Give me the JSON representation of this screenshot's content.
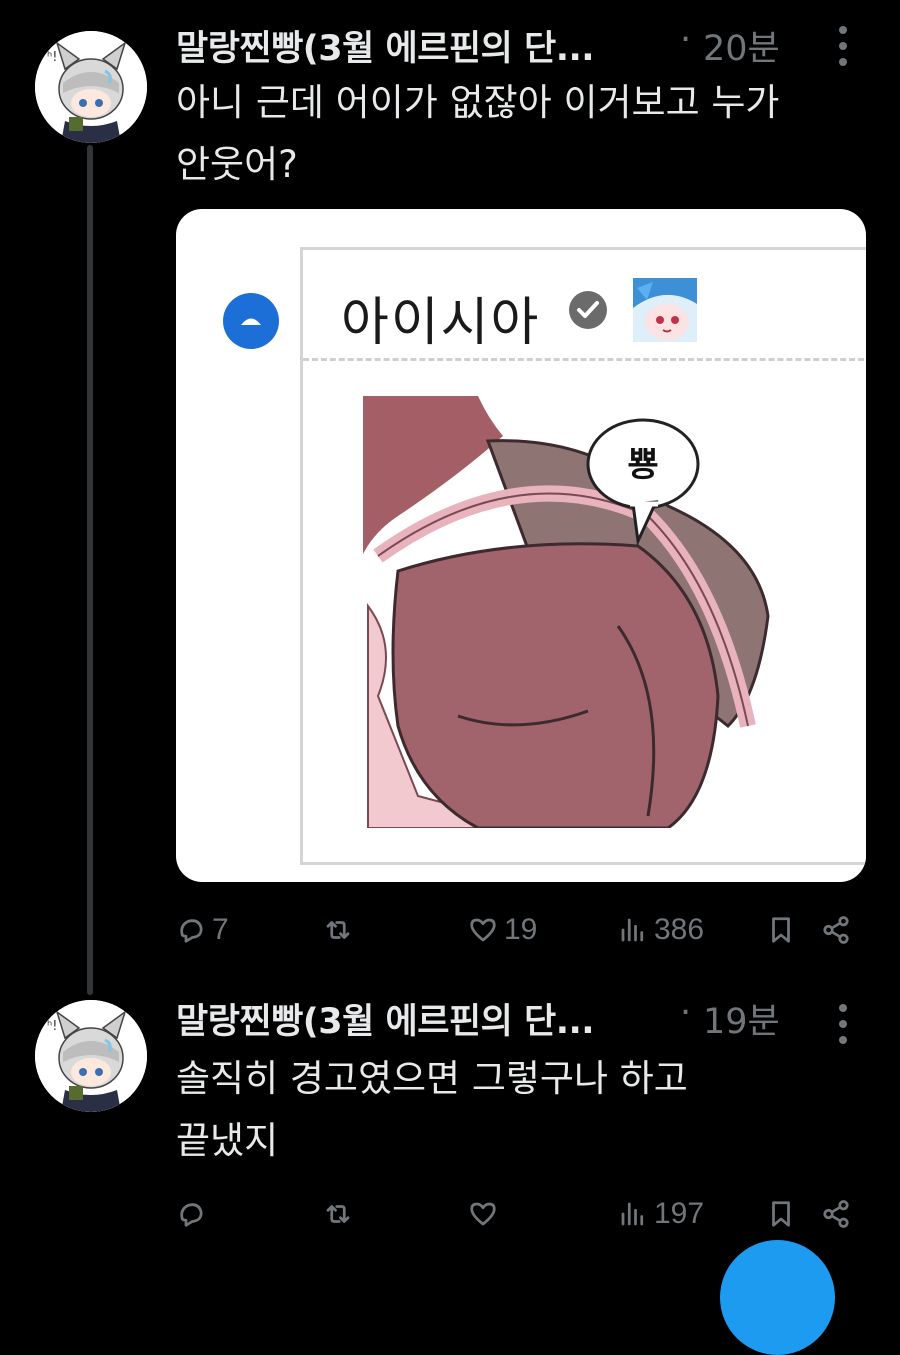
{
  "tweets": [
    {
      "handle": "말랑찐빵(3월 에르핀의 단...",
      "separator": "·",
      "time": "20분",
      "text_lines": [
        "아니 근데 어이가 없잖아 이거보고 누가",
        "안웃어?"
      ],
      "media": {
        "quoted_name": "아이시아",
        "speech_bubble": "뿅"
      },
      "stats": {
        "replies": "7",
        "retweets": "",
        "likes": "19",
        "views": "386"
      }
    },
    {
      "handle": "말랑찐빵(3월 에르핀의 단...",
      "separator": "·",
      "time": "19분",
      "text_lines": [
        "솔직히 경고였으면 그렇구나 하고",
        "끝냈지"
      ],
      "stats": {
        "replies": "",
        "retweets": "",
        "likes": "",
        "views": "197"
      }
    }
  ],
  "colors": {
    "background": "#000000",
    "text": "#e7e9ea",
    "muted": "#71767b",
    "accent": "#1d9bf0"
  },
  "icons": [
    "more-icon",
    "reply-icon",
    "retweet-icon",
    "like-icon",
    "views-icon",
    "bookmark-icon",
    "share-icon",
    "verified-icon",
    "collapse-up-icon"
  ]
}
